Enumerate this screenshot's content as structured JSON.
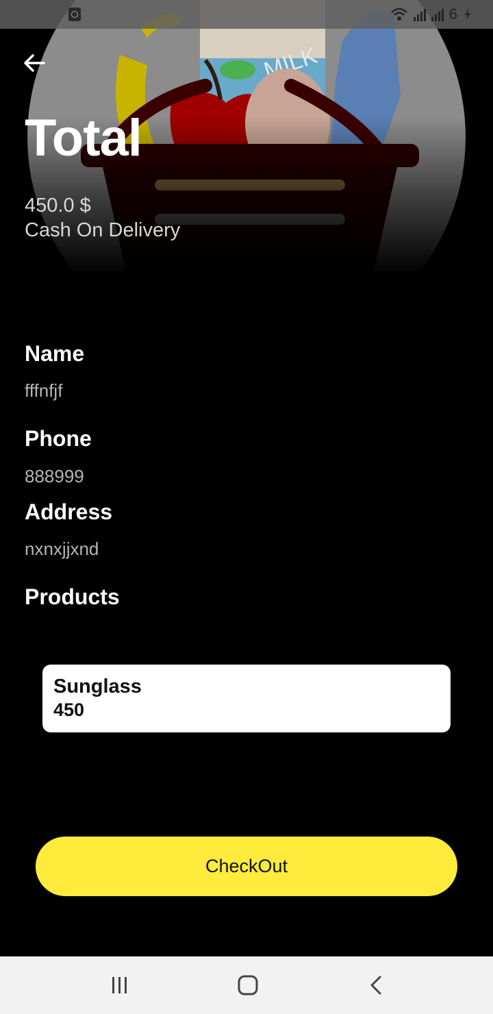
{
  "status_bar": {
    "battery_text": "6",
    "icons": [
      "app-notification-icon",
      "wifi-icon",
      "signal-icon",
      "signal-icon",
      "charging-icon"
    ]
  },
  "header": {
    "back_icon": "arrow-left-icon",
    "title": "Total",
    "amount": "450.0 $",
    "payment_method": "Cash On Delivery",
    "hero_text": "MILK"
  },
  "details": {
    "name_label": "Name",
    "name_value": "fffnfjf",
    "phone_label": "Phone",
    "phone_value": "888999",
    "address_label": "Address",
    "address_value": "nxnxjjxnd",
    "products_label": "Products"
  },
  "products": [
    {
      "name": "Sunglass",
      "price": "450"
    }
  ],
  "checkout": {
    "label": "CheckOut",
    "color": "#ffeb3b"
  },
  "nav_bar": {
    "icons": [
      "recent-apps-icon",
      "home-icon",
      "back-icon"
    ]
  }
}
